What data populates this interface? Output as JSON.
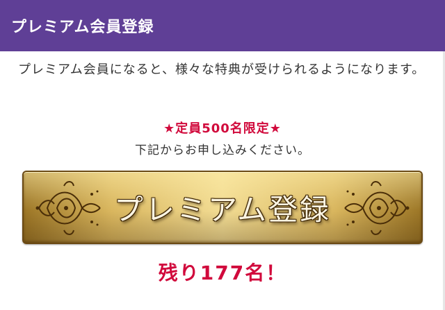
{
  "header": {
    "title": "プレミアム会員登録"
  },
  "content": {
    "intro": "プレミアム会員になると、様々な特典が受けられるようになります。",
    "limit_notice": "★定員500名限定★",
    "apply_prompt": "下記からお申し込みください。",
    "button_label": "プレミアム登録",
    "remaining": "残り177名！"
  },
  "colors": {
    "header_bg": "#5f3f96",
    "accent_red": "#d10a3c",
    "button_gold": "#d9b65e"
  }
}
